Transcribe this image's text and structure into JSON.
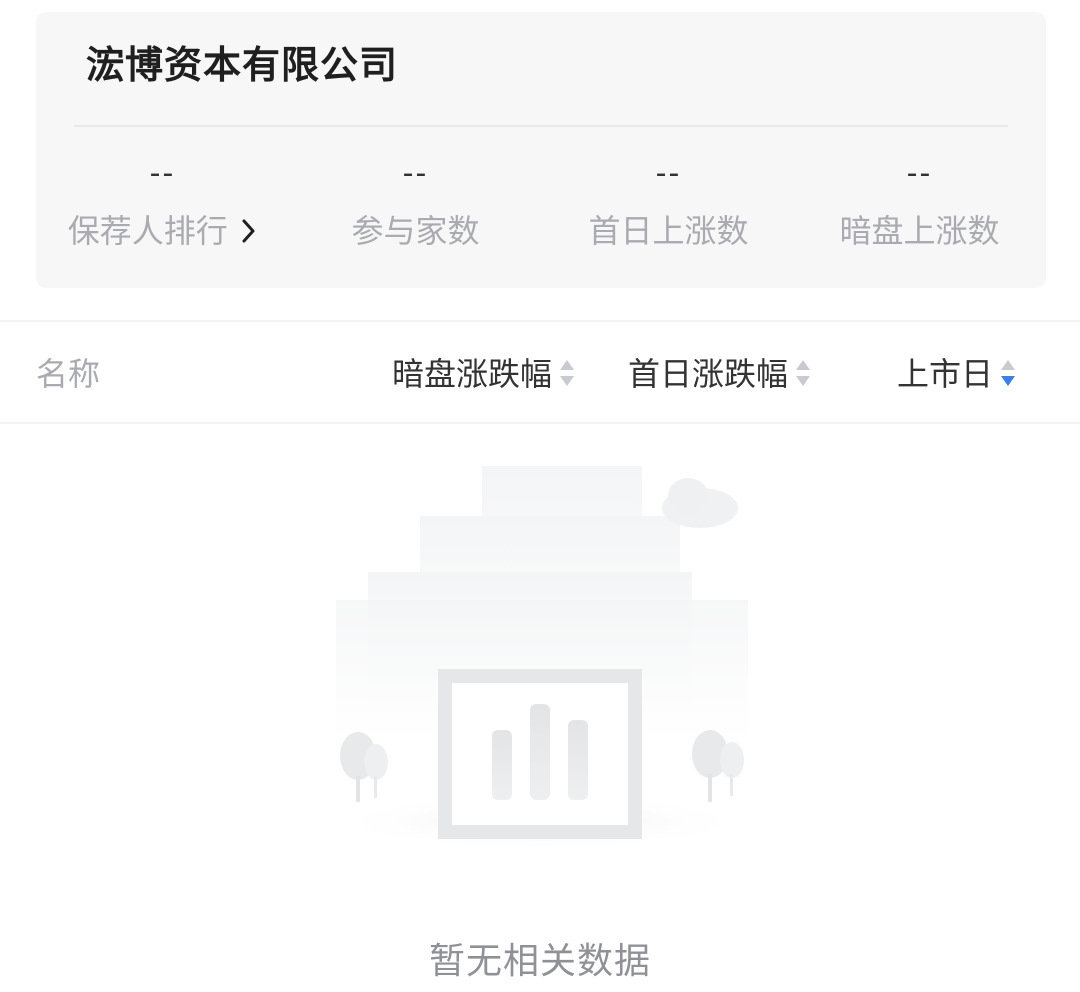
{
  "card": {
    "company_name": "浤博资本有限公司",
    "stats": [
      {
        "value": "--",
        "label": "保荐人排行"
      },
      {
        "value": "--",
        "label": "参与家数"
      },
      {
        "value": "--",
        "label": "首日上涨数"
      },
      {
        "value": "--",
        "label": "暗盘上涨数"
      }
    ],
    "ranking_chevron": "›"
  },
  "table_header": {
    "name_label": "名称",
    "dark_pool_change_label": "暗盘涨跌幅",
    "first_day_change_label": "首日涨跌幅",
    "listing_date_label": "上市日",
    "active_sort": "listing_date_desc"
  },
  "empty_state": {
    "message": "暂无相关数据",
    "illustration": "empty-chart-illustration"
  },
  "colors": {
    "accent": "#3b7fe6",
    "card_bg": "#f7f7f8",
    "muted_text": "#a9abb0"
  }
}
